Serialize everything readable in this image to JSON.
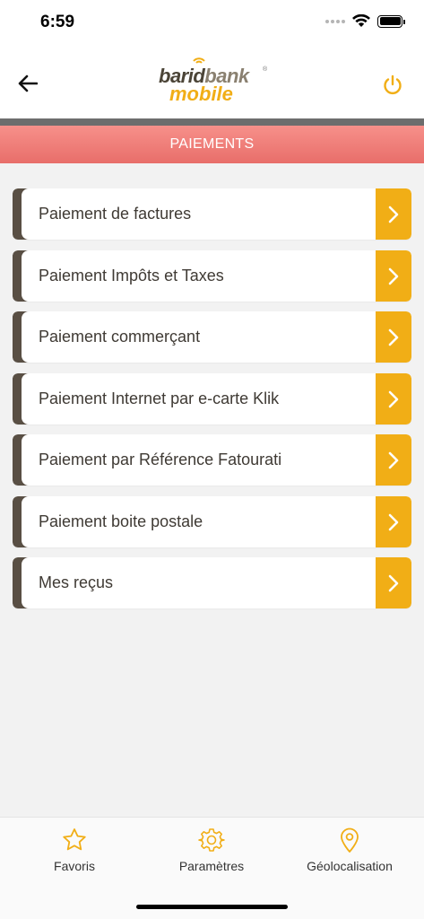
{
  "status_bar": {
    "time": "6:59"
  },
  "header": {
    "logo": {
      "part1": "barid",
      "part2": "bank",
      "part3": "mobile",
      "reg": "®"
    },
    "back_icon": "arrow-left-icon",
    "logout_icon": "power-icon"
  },
  "page": {
    "title": "PAIEMENTS"
  },
  "menu": {
    "items": [
      {
        "label": "Paiement de factures"
      },
      {
        "label": "Paiement Impôts et Taxes"
      },
      {
        "label": "Paiement commerçant"
      },
      {
        "label": "Paiement Internet par e-carte Klik"
      },
      {
        "label": "Paiement par Référence Fatourati"
      },
      {
        "label": "Paiement boite postale"
      },
      {
        "label": "Mes reçus"
      }
    ]
  },
  "tab_bar": {
    "tabs": [
      {
        "label": "Favoris",
        "icon": "star-icon"
      },
      {
        "label": "Paramètres",
        "icon": "gear-icon"
      },
      {
        "label": "Géolocalisation",
        "icon": "location-pin-icon"
      }
    ]
  },
  "colors": {
    "accent": "#f1ae16",
    "brown": "#594f44",
    "title_band": "#ee7c77"
  }
}
